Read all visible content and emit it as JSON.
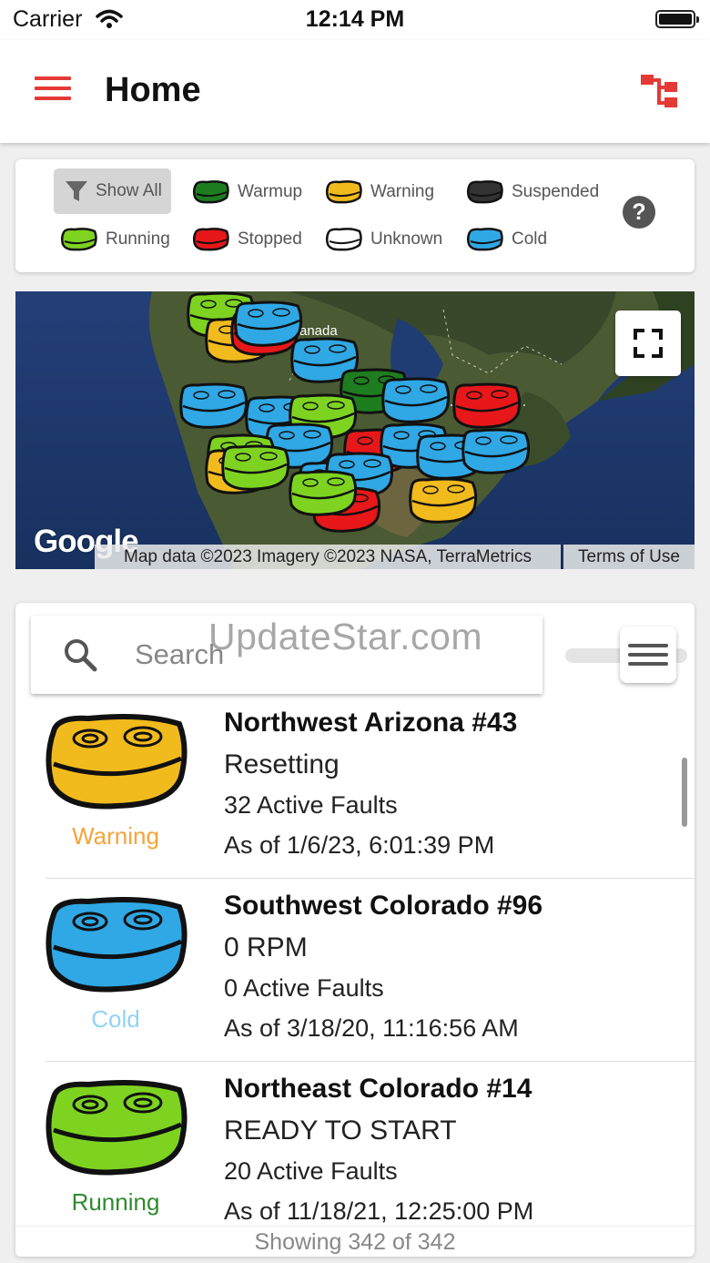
{
  "status_bar": {
    "carrier": "Carrier",
    "time": "12:14 PM"
  },
  "header": {
    "title": "Home",
    "menu_icon": "hamburger-icon",
    "action_icon": "tree-icon"
  },
  "colors": {
    "accent": "#e53935",
    "warmup": "#1e7d1e",
    "warning": "#f2bb1d",
    "suspended": "#333333",
    "running": "#7ed321",
    "stopped": "#e8171a",
    "unknown": "#ffffff",
    "cold": "#2fa8e5"
  },
  "legend": {
    "show_all": "Show All",
    "items": [
      {
        "label": "Warmup",
        "color": "#1e7d1e"
      },
      {
        "label": "Warning",
        "color": "#f2bb1d"
      },
      {
        "label": "Suspended",
        "color": "#333333"
      },
      {
        "label": "Running",
        "color": "#7ed321"
      },
      {
        "label": "Stopped",
        "color": "#e8171a"
      },
      {
        "label": "Unknown",
        "color": "#ffffff"
      },
      {
        "label": "Cold",
        "color": "#2fa8e5"
      }
    ],
    "help": "?"
  },
  "map": {
    "google_logo": "Google",
    "attribution": "Map data ©2023 Imagery ©2023 NASA, TerraMetrics",
    "terms": "Terms of Use",
    "label_canada": "anada"
  },
  "search": {
    "placeholder": "Search",
    "watermark": "UpdateStar.com"
  },
  "units": [
    {
      "name": "Northwest Arizona #43",
      "state": "Resetting",
      "faults": "32 Active Faults",
      "as_of": "As of 1/6/23, 6:01:39 PM",
      "status": "Warning",
      "color": "#f2bb1d",
      "status_color": "#f4a43b"
    },
    {
      "name": "Southwest Colorado #96",
      "state": "0 RPM",
      "faults": "0 Active Faults",
      "as_of": "As of 3/18/20, 11:16:56 AM",
      "status": "Cold",
      "color": "#2fa8e5",
      "status_color": "#8fd3f5"
    },
    {
      "name": "Northeast Colorado #14",
      "state": "READY TO START",
      "faults": "20 Active Faults",
      "as_of": "As of 11/18/21, 12:25:00 PM",
      "status": "Running",
      "color": "#7ed321",
      "status_color": "#2e8b2e"
    }
  ],
  "footer": {
    "text": "Showing 342 of 342"
  }
}
